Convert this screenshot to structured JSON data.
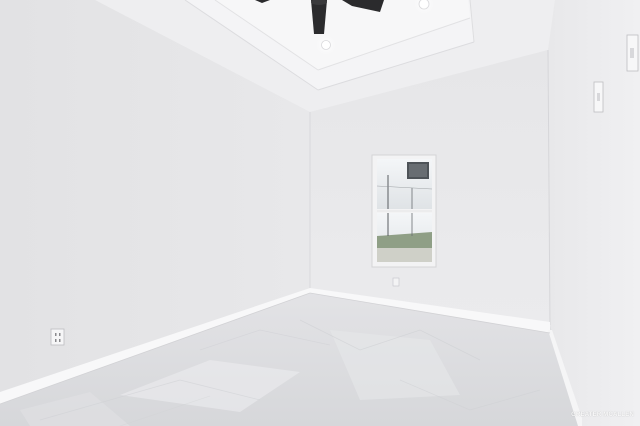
{
  "photo": {
    "subject": "empty-room-interior",
    "watermark": "GREATER MCALLEN",
    "colors": {
      "left_wall": "#e6e6e8",
      "back_wall": "#e9e9eb",
      "right_wall": "#ededef",
      "ceiling": "#f1f1f3",
      "floor": "#dcdde0",
      "baseboard": "#f8f8f9",
      "fan_blade": "#2c2c2e"
    }
  }
}
